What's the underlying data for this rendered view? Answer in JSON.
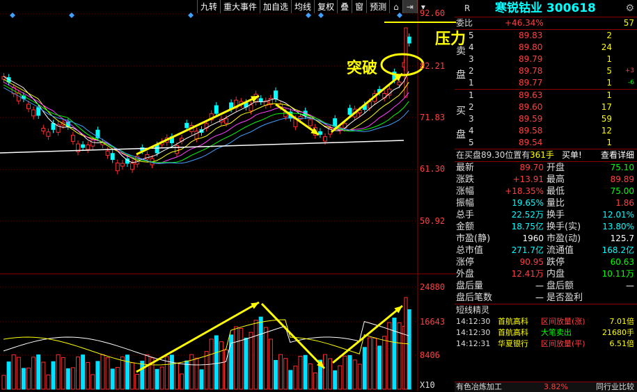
{
  "toolbar": {
    "items": [
      "九转",
      "重大事件",
      "加自选",
      "均线",
      "复权",
      "叠",
      "窗",
      "预测"
    ],
    "icons": [
      "home-icon",
      "next-icon",
      "dropdown-icon"
    ]
  },
  "chart": {
    "price_axis": [
      "92.60",
      "82.21",
      "71.83",
      "61.30",
      "50.92"
    ],
    "volume_axis": [
      "24880",
      "16643",
      "8406",
      "X10"
    ]
  },
  "annotations": {
    "pressure": "压力",
    "breakout": "突破"
  },
  "stock": {
    "market": "R",
    "name": "寒锐钴业 300618",
    "committee_label": "委比",
    "committee_ratio": "+46.34%",
    "committee_diff": "57"
  },
  "orderbook": {
    "sell_side_label": [
      "卖",
      "盘"
    ],
    "buy_side_label": [
      "买",
      "盘"
    ],
    "sells": [
      {
        "level": "5",
        "price": "89.83",
        "qty": "2",
        "chg": ""
      },
      {
        "level": "4",
        "price": "89.80",
        "qty": "24",
        "chg": ""
      },
      {
        "level": "3",
        "price": "89.79",
        "qty": "1",
        "chg": ""
      },
      {
        "level": "2",
        "price": "89.78",
        "qty": "5",
        "chg": "+3"
      },
      {
        "level": "1",
        "price": "89.77",
        "qty": "1",
        "chg": "-6"
      }
    ],
    "buys": [
      {
        "level": "1",
        "price": "89.63",
        "qty": "1"
      },
      {
        "level": "2",
        "price": "89.60",
        "qty": "17"
      },
      {
        "level": "3",
        "price": "89.59",
        "qty": "59"
      },
      {
        "level": "4",
        "price": "89.58",
        "qty": "12"
      },
      {
        "level": "5",
        "price": "89.54",
        "qty": "1"
      }
    ]
  },
  "trade_line": {
    "text": "在买盘89.30位置有",
    "qty": "361手",
    "side": "买单!",
    "link": "查看详细"
  },
  "stats": [
    {
      "l1": "最新",
      "v1": "89.70",
      "c1": "red",
      "l2": "开盘",
      "v2": "75.10",
      "c2": "grn"
    },
    {
      "l1": "涨跌",
      "v1": "+13.91",
      "c1": "red",
      "l2": "最高",
      "v2": "89.89",
      "c2": "red"
    },
    {
      "l1": "涨幅",
      "v1": "+18.35%",
      "c1": "red",
      "l2": "最低",
      "v2": "75.00",
      "c2": "grn"
    },
    {
      "l1": "振幅",
      "v1": "19.65%",
      "c1": "cyan",
      "l2": "量比",
      "v2": "1.86",
      "c2": "red"
    },
    {
      "l1": "总手",
      "v1": "22.52万",
      "c1": "cyan",
      "l2": "换手",
      "v2": "12.01%",
      "c2": "cyan"
    },
    {
      "l1": "金额",
      "v1": "18.75亿",
      "c1": "cyan",
      "l2": "换手(实)",
      "v2": "13.80%",
      "c2": "cyan"
    },
    {
      "l1": "市盈(静)",
      "v1": "1960",
      "c1": "wht",
      "l2": "市盈(动)",
      "v2": "125.7",
      "c2": "wht"
    },
    {
      "l1": "总市值",
      "v1": "271.7亿",
      "c1": "cyan",
      "l2": "流通值",
      "v2": "168.2亿",
      "c2": "cyan"
    },
    {
      "l1": "涨停",
      "v1": "90.95",
      "c1": "red",
      "l2": "跌停",
      "v2": "60.63",
      "c2": "grn"
    },
    {
      "l1": "外盘",
      "v1": "12.41万",
      "c1": "red",
      "l2": "内盘",
      "v2": "10.11万",
      "c2": "grn"
    },
    {
      "l1": "盘后量",
      "v1": "—",
      "c1": "wht",
      "l2": "盘后额",
      "v2": "—",
      "c2": "wht"
    },
    {
      "l1": "盘后笔数",
      "v1": "—",
      "c1": "wht",
      "l2": "是否盈利",
      "v2": "",
      "c2": "wht"
    }
  ],
  "short_term": {
    "title": "短线精灵",
    "rows": [
      {
        "time": "14:12:30",
        "name": "首航高科",
        "event": "区间放量(涨)",
        "val": "7.01倍",
        "g": false
      },
      {
        "time": "14:12:30",
        "name": "首航高科",
        "event": "大笔卖出",
        "val": "21680手",
        "g": true
      },
      {
        "time": "14:12:31",
        "name": "华夏银行",
        "event": "区间放量(平)",
        "val": "6.51倍",
        "g": false
      }
    ]
  },
  "footer": {
    "sector": "有色冶炼加工",
    "pct": "3.82%",
    "compare": "同行业比较"
  }
}
